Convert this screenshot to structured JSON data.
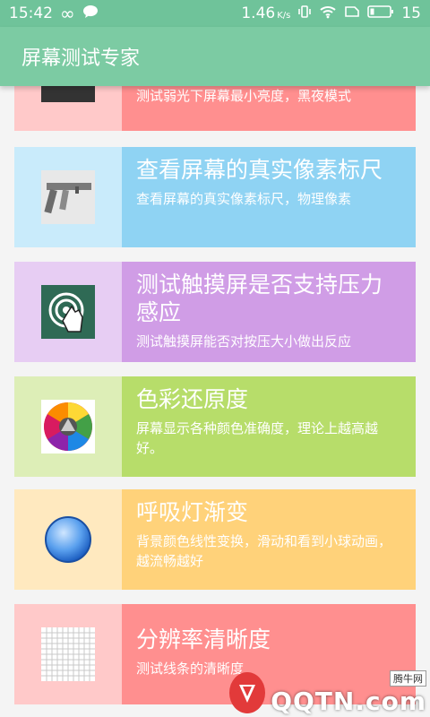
{
  "status_bar": {
    "time": "15:42",
    "speed": "1.46",
    "speed_unit": "K/s",
    "battery": "15"
  },
  "app_bar": {
    "title": "屏幕测试专家"
  },
  "items": [
    {
      "title": "",
      "desc": "测试弱光下屏幕最小亮度，黑夜模式",
      "color": "#ff8f8f",
      "thumb_color": "#ffc9c9"
    },
    {
      "title": "查看屏幕的真实像素标尺",
      "desc": "查看屏幕的真实像素标尺，物理像素",
      "color": "#8fd3f3",
      "thumb_color": "#c9ebfb",
      "icon": "caliper-icon"
    },
    {
      "title": "测试触摸屏是否支持压力感应",
      "desc": "测试触摸屏能否对按压大小做出反应",
      "color": "#d09de6",
      "thumb_color": "#e7cdf3",
      "icon": "touch-pressure-icon"
    },
    {
      "title": "色彩还原度",
      "desc": "屏幕显示各种颜色准确度，理论上越高越好。",
      "color": "#b7dd6a",
      "thumb_color": "#ddeeb7",
      "icon": "color-wheel-icon"
    },
    {
      "title": "呼吸灯渐变",
      "desc": "背景颜色线性变换，滑动和看到小球动画，越流畅越好",
      "color": "#ffd27a",
      "thumb_color": "#ffe9bf",
      "icon": "blue-ball-icon"
    },
    {
      "title": "分辨率清晰度",
      "desc": "测试线条的清晰度",
      "color": "#ff8f8f",
      "thumb_color": "#ffc9c9",
      "icon": "grid-icon"
    }
  ],
  "watermark": {
    "top": "腾牛网",
    "brand": "QQTN.com"
  }
}
